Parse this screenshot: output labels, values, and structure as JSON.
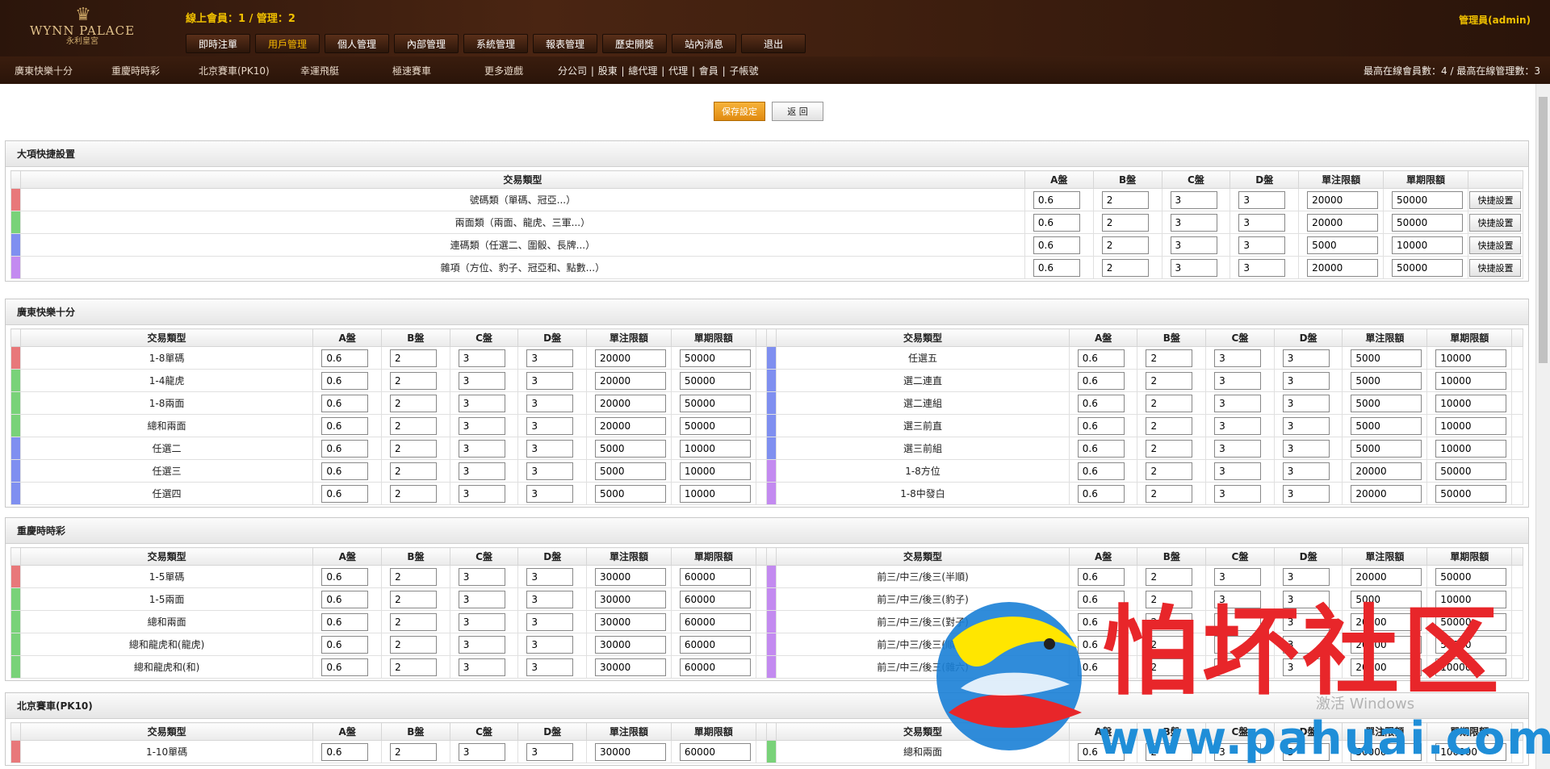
{
  "header": {
    "logo_crest": "♛",
    "logo_brand": "WYNN PALACE",
    "logo_sub": "永利皇宮",
    "online": "線上會員：1 / 管理：2",
    "admin": "管理員(admin)",
    "nav": [
      "即時注單",
      "用戶管理",
      "個人管理",
      "內部管理",
      "系統管理",
      "報表管理",
      "歷史開獎",
      "站內消息",
      "退出"
    ],
    "games": [
      "廣東快樂十分",
      "重慶時時彩",
      "北京賽車(PK10)",
      "幸運飛艇",
      "極速賽車",
      "更多遊戲"
    ],
    "roles": [
      "分公司",
      "股東",
      "總代理",
      "代理",
      "會員",
      "子帳號"
    ],
    "stats": "最高在線會員數：4 / 最高在線管理數：3"
  },
  "actions": {
    "save": "保存設定",
    "back": "返 回"
  },
  "headers": {
    "type": "交易類型",
    "a": "A盤",
    "b": "B盤",
    "c": "C盤",
    "d": "D盤",
    "single": "單注限額",
    "period": "單期限額"
  },
  "quick": {
    "title": "大項快捷設置",
    "button": "快捷設置",
    "rows": [
      {
        "name": "號碼類（單碼、冠亞...）",
        "a": "0.6",
        "b": "2",
        "c": "3",
        "d": "3",
        "s": "20000",
        "p": "50000"
      },
      {
        "name": "兩面類（兩面、龍虎、三軍...）",
        "a": "0.6",
        "b": "2",
        "c": "3",
        "d": "3",
        "s": "20000",
        "p": "50000"
      },
      {
        "name": "連碼類（任選二、圍骰、長牌...）",
        "a": "0.6",
        "b": "2",
        "c": "3",
        "d": "3",
        "s": "5000",
        "p": "10000"
      },
      {
        "name": "雜項（方位、豹子、冠亞和、點數...）",
        "a": "0.6",
        "b": "2",
        "c": "3",
        "d": "3",
        "s": "20000",
        "p": "50000"
      }
    ]
  },
  "gd": {
    "title": "廣東快樂十分",
    "left": [
      {
        "name": "1-8單碼",
        "a": "0.6",
        "b": "2",
        "c": "3",
        "d": "3",
        "s": "20000",
        "p": "50000"
      },
      {
        "name": "1-4龍虎",
        "a": "0.6",
        "b": "2",
        "c": "3",
        "d": "3",
        "s": "20000",
        "p": "50000"
      },
      {
        "name": "1-8兩面",
        "a": "0.6",
        "b": "2",
        "c": "3",
        "d": "3",
        "s": "20000",
        "p": "50000"
      },
      {
        "name": "總和兩面",
        "a": "0.6",
        "b": "2",
        "c": "3",
        "d": "3",
        "s": "20000",
        "p": "50000"
      },
      {
        "name": "任選二",
        "a": "0.6",
        "b": "2",
        "c": "3",
        "d": "3",
        "s": "5000",
        "p": "10000"
      },
      {
        "name": "任選三",
        "a": "0.6",
        "b": "2",
        "c": "3",
        "d": "3",
        "s": "5000",
        "p": "10000"
      },
      {
        "name": "任選四",
        "a": "0.6",
        "b": "2",
        "c": "3",
        "d": "3",
        "s": "5000",
        "p": "10000"
      }
    ],
    "right": [
      {
        "name": "任選五",
        "a": "0.6",
        "b": "2",
        "c": "3",
        "d": "3",
        "s": "5000",
        "p": "10000"
      },
      {
        "name": "選二連直",
        "a": "0.6",
        "b": "2",
        "c": "3",
        "d": "3",
        "s": "5000",
        "p": "10000"
      },
      {
        "name": "選二連組",
        "a": "0.6",
        "b": "2",
        "c": "3",
        "d": "3",
        "s": "5000",
        "p": "10000"
      },
      {
        "name": "選三前直",
        "a": "0.6",
        "b": "2",
        "c": "3",
        "d": "3",
        "s": "5000",
        "p": "10000"
      },
      {
        "name": "選三前組",
        "a": "0.6",
        "b": "2",
        "c": "3",
        "d": "3",
        "s": "5000",
        "p": "10000"
      },
      {
        "name": "1-8方位",
        "a": "0.6",
        "b": "2",
        "c": "3",
        "d": "3",
        "s": "20000",
        "p": "50000"
      },
      {
        "name": "1-8中發白",
        "a": "0.6",
        "b": "2",
        "c": "3",
        "d": "3",
        "s": "20000",
        "p": "50000"
      }
    ]
  },
  "cq": {
    "title": "重慶時時彩",
    "left": [
      {
        "name": "1-5單碼",
        "a": "0.6",
        "b": "2",
        "c": "3",
        "d": "3",
        "s": "30000",
        "p": "60000"
      },
      {
        "name": "1-5兩面",
        "a": "0.6",
        "b": "2",
        "c": "3",
        "d": "3",
        "s": "30000",
        "p": "60000"
      },
      {
        "name": "總和兩面",
        "a": "0.6",
        "b": "2",
        "c": "3",
        "d": "3",
        "s": "30000",
        "p": "60000"
      },
      {
        "name": "總和龍虎和(龍虎)",
        "a": "0.6",
        "b": "2",
        "c": "3",
        "d": "3",
        "s": "30000",
        "p": "60000"
      },
      {
        "name": "總和龍虎和(和)",
        "a": "0.6",
        "b": "2",
        "c": "3",
        "d": "3",
        "s": "30000",
        "p": "60000"
      }
    ],
    "right": [
      {
        "name": "前三/中三/後三(半順)",
        "a": "0.6",
        "b": "2",
        "c": "3",
        "d": "3",
        "s": "20000",
        "p": "50000"
      },
      {
        "name": "前三/中三/後三(豹子)",
        "a": "0.6",
        "b": "2",
        "c": "3",
        "d": "3",
        "s": "5000",
        "p": "10000"
      },
      {
        "name": "前三/中三/後三(對子)",
        "a": "0.6",
        "b": "2",
        "c": "3",
        "d": "3",
        "s": "20000",
        "p": "50000"
      },
      {
        "name": "前三/中三/後三(順子)",
        "a": "0.6",
        "b": "2",
        "c": "3",
        "d": "3",
        "s": "20000",
        "p": "50000"
      },
      {
        "name": "前三/中三/後三(雜六)",
        "a": "0.6",
        "b": "2",
        "c": "3",
        "d": "3",
        "s": "20000",
        "p": "100000"
      }
    ]
  },
  "pk": {
    "title": "北京賽車(PK10)",
    "left": [
      {
        "name": "1-10單碼",
        "a": "0.6",
        "b": "2",
        "c": "3",
        "d": "3",
        "s": "30000",
        "p": "60000"
      }
    ],
    "right": [
      {
        "name": "總和兩面",
        "a": "0.6",
        "b": "2",
        "c": "3",
        "d": "3",
        "s": "50000",
        "p": "100000"
      }
    ]
  },
  "watermark": {
    "cn": "怕坏社区",
    "url": "www.pahuai.com",
    "windows": "激活 Windows"
  },
  "colors": {
    "red": "#e8787a",
    "green": "#79d279",
    "blue": "#7f8ff0",
    "purple": "#c38af0",
    "gold": "#f0c000"
  }
}
